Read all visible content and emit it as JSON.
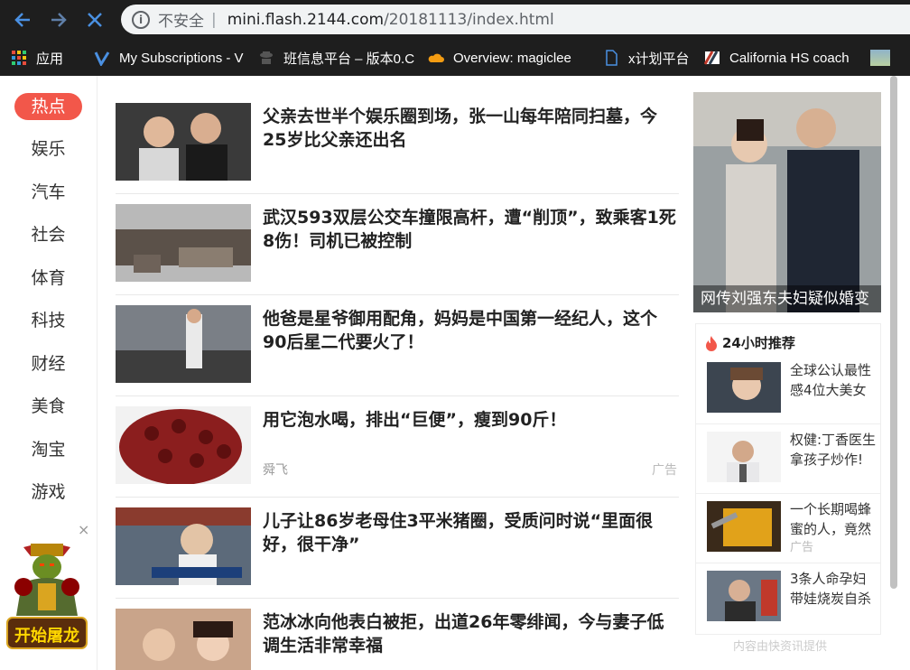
{
  "browser": {
    "security_label": "不安全",
    "separator": "|",
    "url_host": "mini.flash.2144.com",
    "url_path": "/20181113/index.html",
    "bookmarks": [
      {
        "label": "应用",
        "icon": "apps-grid-icon"
      },
      {
        "label": "My Subscriptions - V",
        "icon": "v-logo-icon"
      },
      {
        "label": "班信息平台 – 版本0.C",
        "icon": "spy-icon"
      },
      {
        "label": "Overview: magiclee",
        "icon": "cloud-icon"
      },
      {
        "label": "x计划平台",
        "icon": "page-icon"
      },
      {
        "label": "California HS coach",
        "icon": "flag-icon"
      }
    ]
  },
  "nav": {
    "categories": [
      "热点",
      "娱乐",
      "汽车",
      "社会",
      "体育",
      "科技",
      "财经",
      "美食",
      "淘宝",
      "游戏"
    ],
    "active_index": 0,
    "close_symbol": "×",
    "game_ad_label": "开始屠龙"
  },
  "feed": [
    {
      "title": "父亲去世半个娱乐圈到场，张一山每年陪同扫墓，今25岁比父亲还出名",
      "source": "",
      "badge": ""
    },
    {
      "title": "武汉593双层公交车撞限高杆，遭“削顶”，致乘客1死8伤！司机已被控制",
      "source": "",
      "badge": ""
    },
    {
      "title": "他爸是星爷御用配角，妈妈是中国第一经纪人，这个90后星二代要火了！",
      "source": "",
      "badge": ""
    },
    {
      "title": "用它泡水喝，排出“巨便”，瘦到90斤！",
      "source": "舜飞",
      "badge": "广告"
    },
    {
      "title": "儿子让86岁老母住3平米猪圈，受质问时说“里面很好，很干净”",
      "source": "",
      "badge": ""
    },
    {
      "title": "范冰冰向他表白被拒，出道26年零绯闻，今与妻子低调生活非常幸福",
      "source": "",
      "badge": ""
    }
  ],
  "hero": {
    "caption": "网传刘强东夫妇疑似婚变"
  },
  "side": {
    "heading": "24小时推荐",
    "items": [
      {
        "title": "全球公认最性感4位大美女",
        "badge": ""
      },
      {
        "title": "权健:丁香医生拿孩子炒作!",
        "badge": ""
      },
      {
        "title": "一个长期喝蜂蜜的人，竟然",
        "badge": "广告"
      },
      {
        "title": "3条人命孕妇带娃烧炭自杀",
        "badge": ""
      }
    ],
    "credit": "内容由快资讯提供"
  },
  "colors": {
    "accent": "#f2574a",
    "chrome": "#1e1e1e"
  }
}
